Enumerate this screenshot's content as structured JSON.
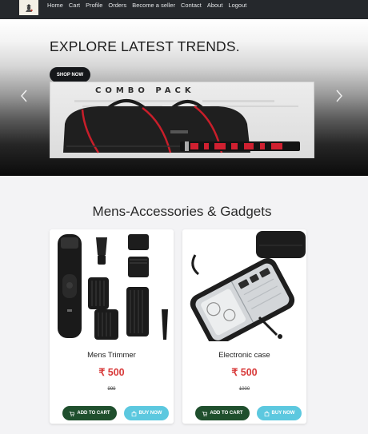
{
  "nav": {
    "links": [
      "Home",
      "Cart",
      "Profile",
      "Orders",
      "Become a seller",
      "Contact",
      "About",
      "Logout"
    ]
  },
  "hero": {
    "title": "EXPLORE LATEST TRENDS.",
    "button": "SHOP NOW",
    "banner_text": "COMBO PACK"
  },
  "section": {
    "title": "Mens-Accessories & Gadgets"
  },
  "products": [
    {
      "name": "Mens Trimmer",
      "price": "₹ 500",
      "mrp": "999",
      "add_to_cart": "ADD TO CART",
      "buy_now": "BUY NOW"
    },
    {
      "name": "Electronic case",
      "price": "₹ 500",
      "mrp": "1000",
      "add_to_cart": "ADD TO CART",
      "buy_now": "BUY NOW"
    }
  ],
  "colors": {
    "navbar": "#25282c",
    "price": "#d83a3a",
    "add_to_cart": "#1f4f2d",
    "buy_now": "#5cc8df"
  },
  "icons": {
    "carousel_prev": "chevron-left-icon",
    "carousel_next": "chevron-right-icon",
    "cart": "cart-icon",
    "bag": "bag-icon"
  }
}
